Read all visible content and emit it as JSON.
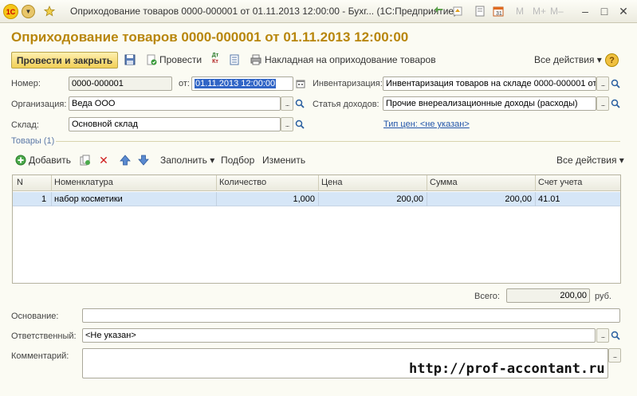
{
  "titlebar": {
    "title": "Оприходование товаров 0000-000001 от 01.11.2013 12:00:00 - Бухг...  (1С:Предприятие)",
    "logo_text": "1С",
    "min": "–",
    "restore": "□",
    "close": "✕",
    "m": "M",
    "mplus": "M+",
    "mminus": "M–"
  },
  "header": {
    "title": "Оприходование товаров 0000-000001 от 01.11.2013 12:00:00"
  },
  "toolbar": {
    "post_close": "Провести и закрыть",
    "post": "Провести",
    "print_label": "Накладная на оприходование товаров",
    "all_actions": "Все действия ▾",
    "dt_kt_top": "Дт",
    "dt_kt_bot": "Кт",
    "help": "?"
  },
  "form": {
    "number_label": "Номер:",
    "number_value": "0000-000001",
    "date_label": "от:",
    "date_value": "01.11.2013 12:00:00",
    "inventory_label": "Инвентаризация:",
    "inventory_value": "Инвентаризация товаров на складе 0000-000001 от",
    "org_label": "Организация:",
    "org_value": "Веда ООО",
    "income_label": "Статья доходов:",
    "income_value": "Прочие внереализационные доходы (расходы)",
    "warehouse_label": "Склад:",
    "warehouse_value": "Основной склад",
    "price_type_link": "Тип цен: <не указан>"
  },
  "goods": {
    "section_label": "Товары (1)",
    "add": "Добавить",
    "fill": "Заполнить ▾",
    "selection": "Подбор",
    "change": "Изменить",
    "all_actions": "Все действия ▾",
    "columns": [
      "N",
      "Номенклатура",
      "Количество",
      "Цена",
      "Сумма",
      "Счет учета"
    ],
    "rows": [
      {
        "n": "1",
        "item": "набор косметики",
        "qty": "1,000",
        "price": "200,00",
        "sum": "200,00",
        "account": "41.01"
      }
    ]
  },
  "totals": {
    "label": "Всего:",
    "value": "200,00",
    "currency": "руб."
  },
  "footer": {
    "basis_label": "Основание:",
    "basis_value": "",
    "responsible_label": "Ответственный:",
    "responsible_value": "<Не указан>",
    "comment_label": "Комментарий:",
    "comment_value": ""
  },
  "watermark": "http://prof-accontant.ru",
  "colors": {
    "title_gold": "#b8860b",
    "primary_button": "#f1cf57",
    "selected_row": "#d6e6f7",
    "link": "#2255aa"
  },
  "icons": [
    "logo-1c",
    "dropdown-menu-icon",
    "star-icon",
    "arrow-back-icon",
    "home-icon",
    "document-icon",
    "calendar-icon",
    "save-icon",
    "post-icon",
    "dt-kt-icon",
    "report-icon",
    "printer-icon",
    "help-icon",
    "add-icon",
    "copy-icon",
    "delete-icon",
    "move-up-icon",
    "move-down-icon",
    "search-icon"
  ]
}
